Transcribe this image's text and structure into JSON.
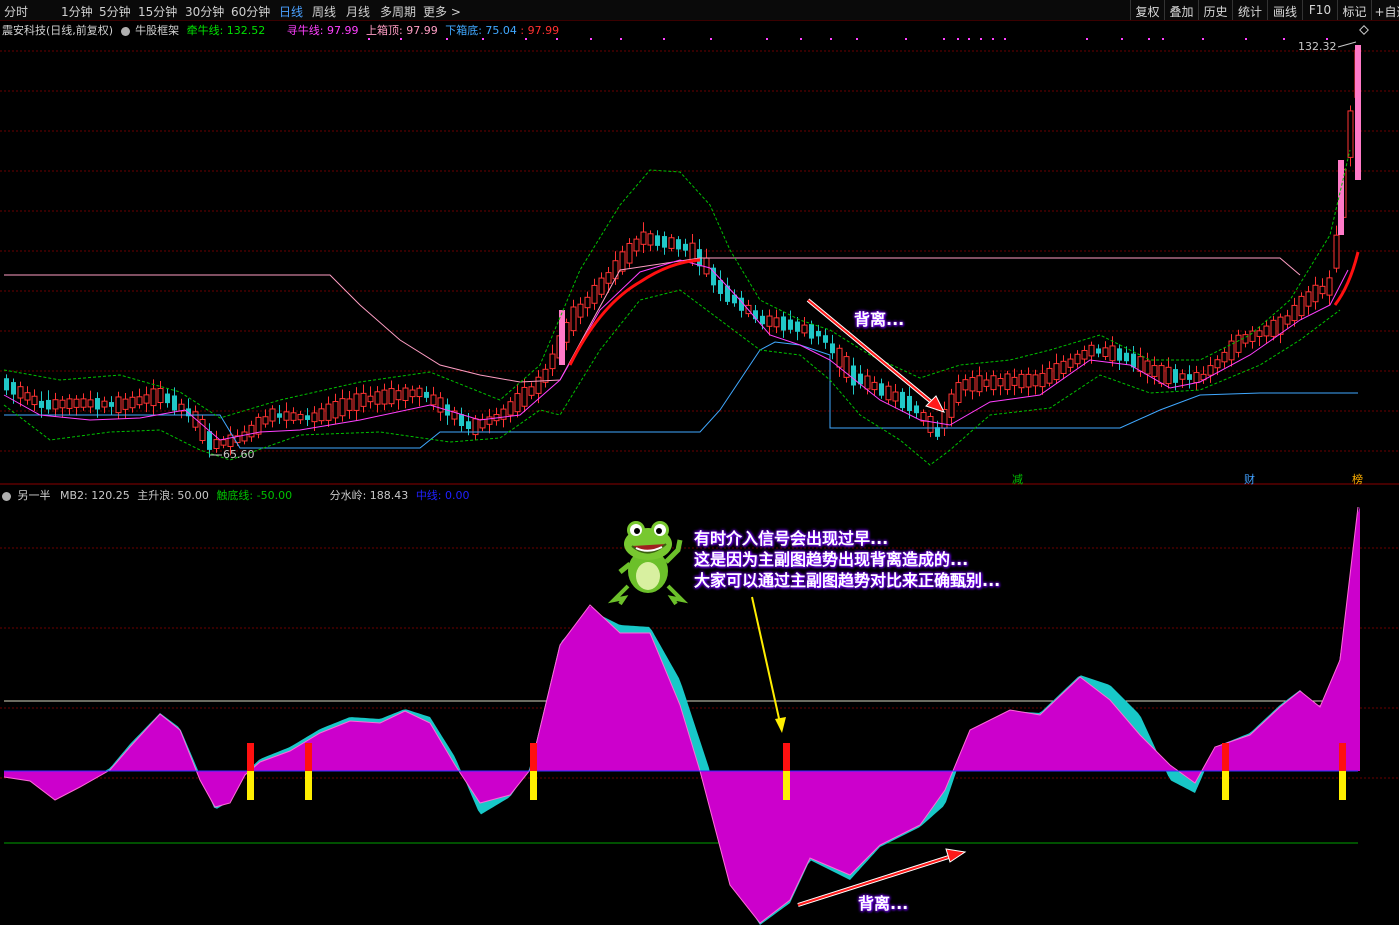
{
  "toolbar": {
    "periods": [
      "分时",
      "1分钟",
      "5分钟",
      "15分钟",
      "30分钟",
      "60分钟",
      "日线",
      "周线",
      "月线",
      "多周期",
      "更多 >"
    ],
    "active_period": "日线",
    "right_buttons": [
      "复权",
      "叠加",
      "历史",
      "统计",
      "画线",
      "F10",
      "标记",
      "+自选"
    ]
  },
  "main_chart": {
    "stock_label": "震安科技(日线,前复权)",
    "indicator_icon": "collapse-circle-icon",
    "indicator_name": "牛股框架",
    "legend": [
      {
        "label": "牵牛线: 132.52",
        "color": "#00e000"
      },
      {
        "label": "寻牛线: 97.99",
        "color": "#ff40ff"
      },
      {
        "label": "上箱顶: 97.99",
        "color": "#ff9ec4"
      },
      {
        "label": "下箱底: 75.04",
        "color": "#40a8ff"
      },
      {
        "label": ": 97.99",
        "color": "#ff3030"
      }
    ],
    "high_label": "132.32",
    "low_label": "65.60",
    "markers": [
      {
        "text": "减",
        "color": "#00c000"
      },
      {
        "text": "财",
        "color": "#40a0ff"
      },
      {
        "text": "榜",
        "color": "#ffb000"
      }
    ],
    "callout": "背离..."
  },
  "sub_chart": {
    "indicator_icon": "collapse-circle-icon",
    "indicator_name": "另一半",
    "legend": [
      {
        "label": "MB2: 120.25",
        "color": "#c8c8c8"
      },
      {
        "label": "主升浪: 50.00",
        "color": "#c8c8c8"
      },
      {
        "label": "触底线: -50.00",
        "color": "#00c000"
      },
      {
        "label": "分水岭: 188.43",
        "color": "#c8c8c8"
      },
      {
        "label": "中线: 0.00",
        "color": "#2020ff"
      }
    ],
    "callout_lines": [
      "有时介入信号会出现过早...",
      "这是因为主副图趋势出现背离造成的...",
      "大家可以通过主副图趋势对比来正确甄别..."
    ],
    "bottom_callout": "背离...",
    "mascot": "frog-mascot-icon"
  },
  "colors": {
    "rise": "#ff3333",
    "fall": "#20c8c8",
    "magenta": "#cc00cc",
    "cyan": "#18c8c8",
    "grid": "#6a0000"
  }
}
